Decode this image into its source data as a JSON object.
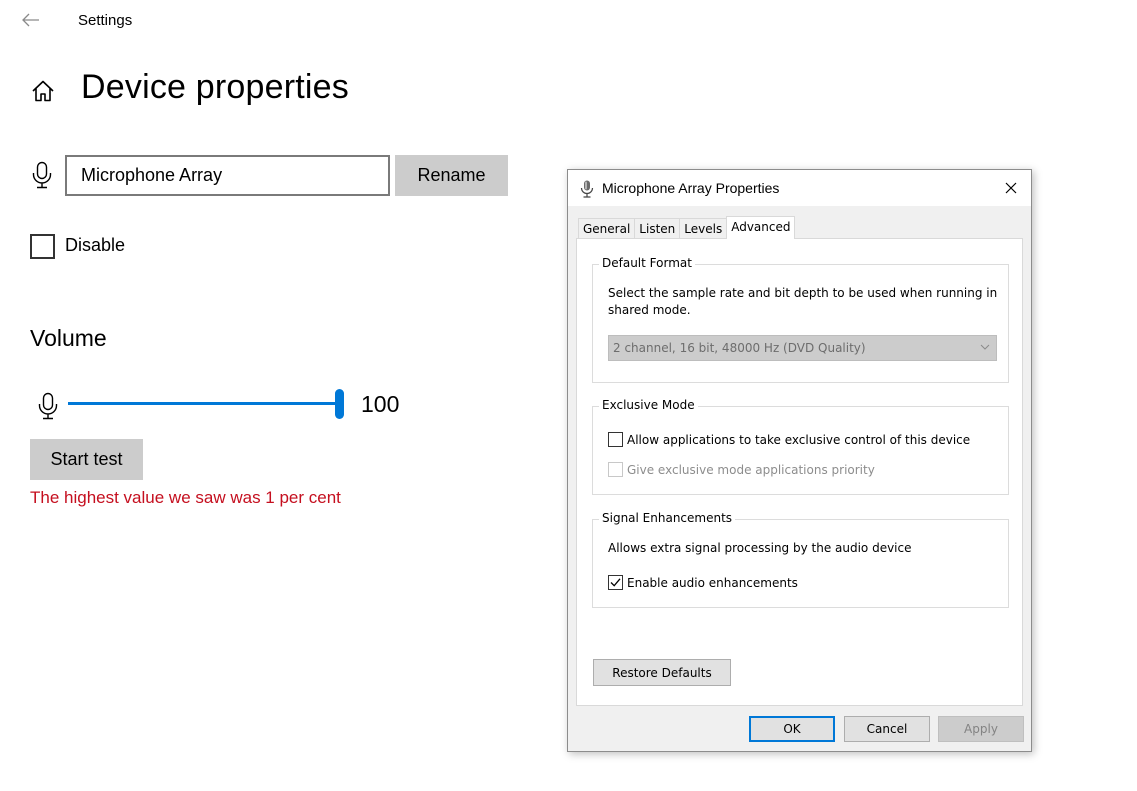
{
  "settings": {
    "app_title": "Settings",
    "page_title": "Device properties",
    "device_name_value": "Microphone Array",
    "rename_label": "Rename",
    "disable_label": "Disable",
    "volume_heading": "Volume",
    "volume_value": "100",
    "volume_level": 100,
    "start_test_label": "Start test",
    "test_result": "The highest value we saw was 1 per cent",
    "accent_color": "#0078d7",
    "result_color": "#c50f1f"
  },
  "dialog": {
    "title": "Microphone Array Properties",
    "tabs": [
      {
        "label": "General"
      },
      {
        "label": "Listen"
      },
      {
        "label": "Levels"
      },
      {
        "label": "Advanced"
      }
    ],
    "default_format": {
      "legend": "Default Format",
      "description": "Select the sample rate and bit depth to be used when running in shared mode.",
      "selected": "2 channel, 16 bit, 48000 Hz (DVD Quality)"
    },
    "exclusive_mode": {
      "legend": "Exclusive Mode",
      "allow_label": "Allow applications to take exclusive control of this device",
      "allow_checked": false,
      "priority_label": "Give exclusive mode applications priority",
      "priority_checked": false
    },
    "signal_enhancements": {
      "legend": "Signal Enhancements",
      "description": "Allows extra signal processing by the audio device",
      "enable_label": "Enable audio enhancements",
      "enable_checked": true
    },
    "restore_label": "Restore Defaults",
    "ok_label": "OK",
    "cancel_label": "Cancel",
    "apply_label": "Apply"
  }
}
